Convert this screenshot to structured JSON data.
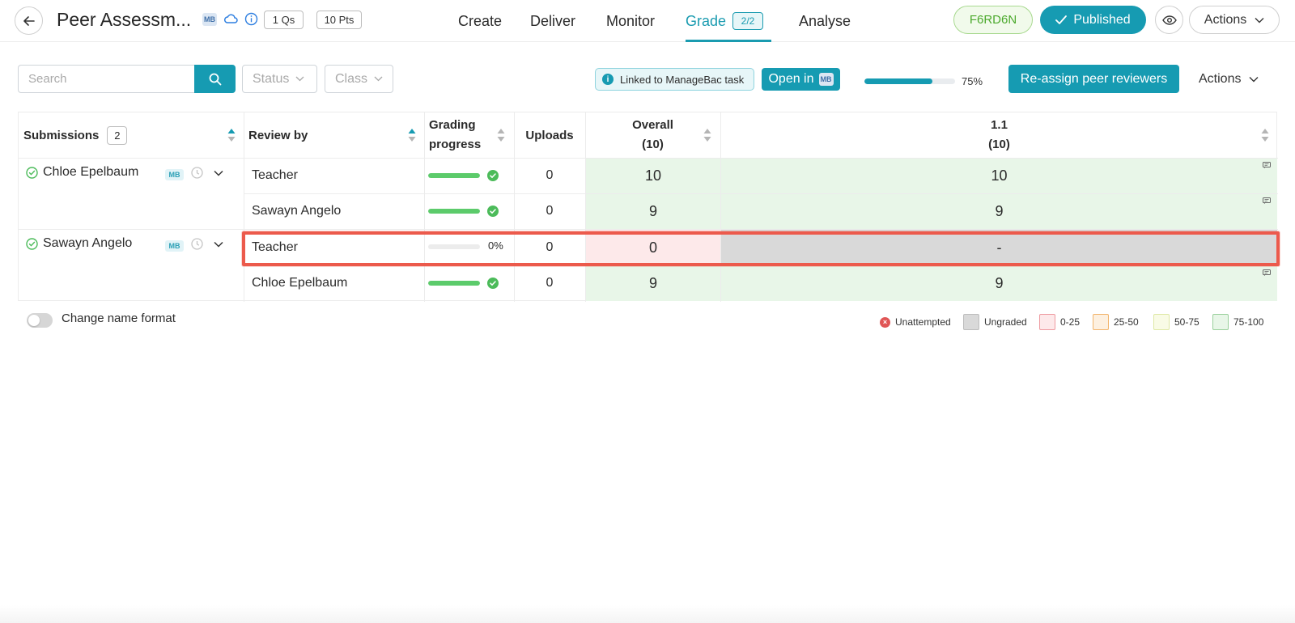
{
  "header": {
    "title": "Peer Assessm...",
    "mb_logo": "MB",
    "questions_badge": "1 Qs",
    "points_badge": "10 Pts",
    "nav": {
      "create": "Create",
      "deliver": "Deliver",
      "monitor": "Monitor",
      "grade": "Grade",
      "grade_badge": "2/2",
      "analyse": "Analyse"
    },
    "code": "F6RD6N",
    "published_label": "Published",
    "actions_label": "Actions"
  },
  "toolbar": {
    "search_placeholder": "Search",
    "status_filter": "Status",
    "class_filter": "Class",
    "linked_label": "Linked to ManageBac task",
    "open_in_label": "Open in",
    "open_in_logo": "MB",
    "progress_percent": 75,
    "progress_label": "75%",
    "reassign_label": "Re-assign peer reviewers",
    "actions_label": "Actions"
  },
  "table": {
    "headers": {
      "submissions": "Submissions",
      "submissions_count": "2",
      "review_by": "Review by",
      "grading_progress_line1": "Grading",
      "grading_progress_line2": "progress",
      "uploads": "Uploads",
      "overall_line1": "Overall",
      "overall_line2": "(10)",
      "q1_line1": "1.1",
      "q1_line2": "(10)"
    },
    "submissions": [
      {
        "student": "Chloe Epelbaum",
        "tag": "MB",
        "reviews": [
          {
            "reviewer": "Teacher",
            "progress": 100,
            "progress_label": "",
            "uploads": "0",
            "overall": "10",
            "q1": "10"
          },
          {
            "reviewer": "Sawayn Angelo",
            "progress": 100,
            "progress_label": "",
            "uploads": "0",
            "overall": "9",
            "q1": "9"
          }
        ]
      },
      {
        "student": "Sawayn Angelo",
        "tag": "MB",
        "reviews": [
          {
            "reviewer": "Teacher",
            "progress": 0,
            "progress_label": "0%",
            "uploads": "0",
            "overall": "0",
            "q1": "-"
          },
          {
            "reviewer": "Chloe Epelbaum",
            "progress": 100,
            "progress_label": "",
            "uploads": "0",
            "overall": "9",
            "q1": "9"
          }
        ]
      }
    ]
  },
  "footer": {
    "toggle_label": "Change name format",
    "legend": {
      "unattempted": "Unattempted",
      "ungraded": "Ungraded",
      "r0_25": "0-25",
      "r25_50": "25-50",
      "r50_75": "50-75",
      "r75_100": "75-100"
    }
  },
  "colors": {
    "accent": "#169bb2",
    "success": "#5ccb6b",
    "highlight": "#ec5a4c"
  }
}
